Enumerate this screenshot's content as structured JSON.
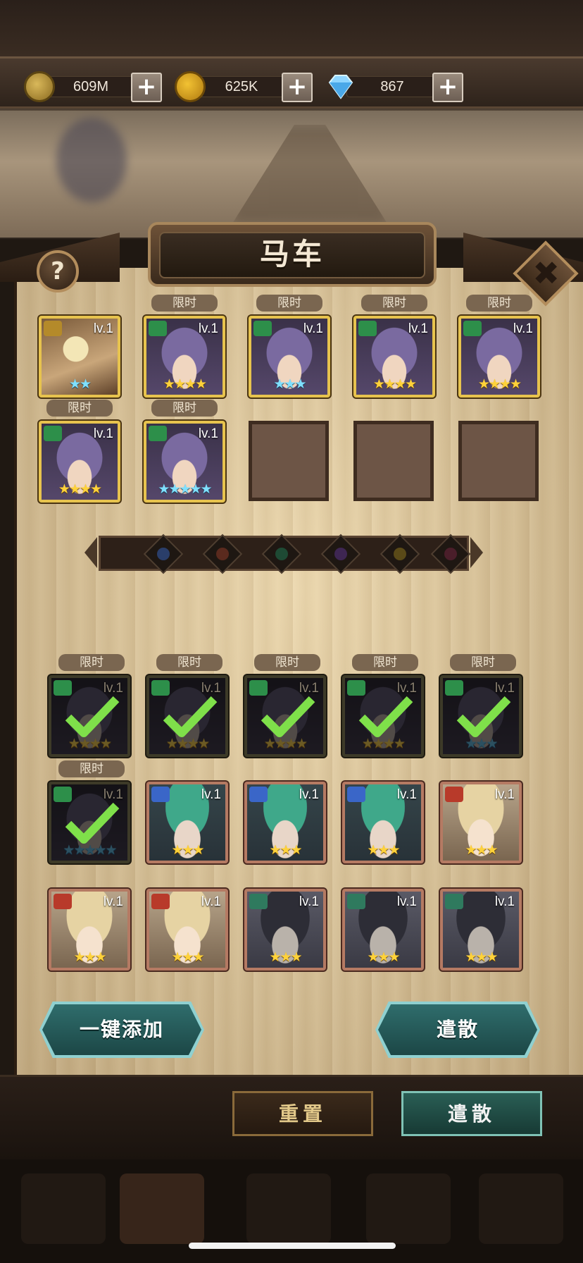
{
  "resources": [
    {
      "name": "gold-coin",
      "value": "609M"
    },
    {
      "name": "gear-token",
      "value": "625K"
    },
    {
      "name": "diamond",
      "value": "867"
    }
  ],
  "title": "马车",
  "help_label": "?",
  "close_label": "✖",
  "limited_tag": "限时",
  "lv_label": "lv.1",
  "selected_heroes": [
    {
      "art": "mask",
      "badge": "y",
      "stars": "★★",
      "star_color": "blue",
      "limited": false
    },
    {
      "art": "purple",
      "badge": "g",
      "stars": "★★★★",
      "star_color": "gold",
      "limited": true
    },
    {
      "art": "purple",
      "badge": "g",
      "stars": "★★★",
      "star_color": "blue",
      "limited": true
    },
    {
      "art": "purple",
      "badge": "g",
      "stars": "★★★★",
      "star_color": "gold",
      "limited": true
    },
    {
      "art": "purple",
      "badge": "g",
      "stars": "★★★★",
      "star_color": "gold",
      "limited": true
    },
    {
      "art": "purple",
      "badge": "g",
      "stars": "★★★★",
      "star_color": "gold",
      "limited": true
    },
    {
      "art": "purple",
      "badge": "g",
      "stars": "★★★★★",
      "star_color": "blue",
      "limited": true
    }
  ],
  "empty_slots": 3,
  "element_filters": [
    "water-icon",
    "fire-icon",
    "nature-icon",
    "shadow-icon",
    "light-icon",
    "chaos-icon"
  ],
  "hero_pool": [
    {
      "art": "purple",
      "badge": "g",
      "stars": "★★★★",
      "star_color": "gold",
      "limited": true,
      "checked": true
    },
    {
      "art": "purple",
      "badge": "g",
      "stars": "★★★★",
      "star_color": "gold",
      "limited": true,
      "checked": true
    },
    {
      "art": "purple",
      "badge": "g",
      "stars": "★★★★",
      "star_color": "gold",
      "limited": true,
      "checked": true
    },
    {
      "art": "purple",
      "badge": "g",
      "stars": "★★★★",
      "star_color": "gold",
      "limited": true,
      "checked": true
    },
    {
      "art": "purple",
      "badge": "g",
      "stars": "★★★",
      "star_color": "blue",
      "limited": true,
      "checked": true
    },
    {
      "art": "purple",
      "badge": "g",
      "stars": "★★★★★",
      "star_color": "blue",
      "limited": true,
      "checked": true
    },
    {
      "art": "green",
      "badge": "b",
      "stars": "★★★",
      "star_color": "gold",
      "limited": false,
      "checked": false
    },
    {
      "art": "green",
      "badge": "b",
      "stars": "★★★",
      "star_color": "gold",
      "limited": false,
      "checked": false
    },
    {
      "art": "green",
      "badge": "b",
      "stars": "★★★",
      "star_color": "gold",
      "limited": false,
      "checked": false
    },
    {
      "art": "blond",
      "badge": "r",
      "stars": "★★★",
      "star_color": "gold",
      "limited": false,
      "checked": false
    },
    {
      "art": "blond",
      "badge": "r",
      "stars": "★★★",
      "star_color": "gold",
      "limited": false,
      "checked": false
    },
    {
      "art": "blond",
      "badge": "r",
      "stars": "★★★",
      "star_color": "gold",
      "limited": false,
      "checked": false
    },
    {
      "art": "hood",
      "badge": "t",
      "stars": "★★★",
      "star_color": "gold",
      "limited": false,
      "checked": false
    },
    {
      "art": "hood",
      "badge": "t",
      "stars": "★★★",
      "star_color": "gold",
      "limited": false,
      "checked": false
    },
    {
      "art": "hood",
      "badge": "t",
      "stars": "★★★",
      "star_color": "gold",
      "limited": false,
      "checked": false
    }
  ],
  "buttons": {
    "auto_add": "一键添加",
    "dismiss_panel": "遣散",
    "reset": "重置",
    "dismiss_bottom": "遣散"
  }
}
